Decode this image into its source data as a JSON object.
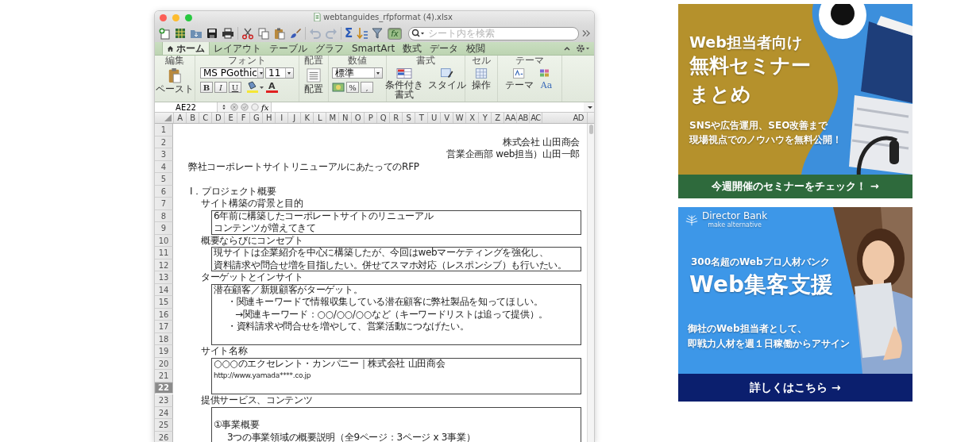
{
  "window": {
    "title": "webtanguides_rfpformat (4).xlsx"
  },
  "toolbar": {
    "buttons": [
      {
        "kind": "new",
        "disabled": false
      },
      {
        "kind": "gallery",
        "disabled": false
      },
      {
        "kind": "open",
        "disabled": false
      },
      {
        "kind": "save",
        "disabled": false
      },
      {
        "kind": "print",
        "disabled": false
      },
      {
        "kind": "cut",
        "disabled": false
      },
      {
        "kind": "copy",
        "disabled": false
      },
      {
        "kind": "paste",
        "disabled": false
      },
      {
        "kind": "brush",
        "disabled": false
      },
      {
        "kind": "undo",
        "disabled": true
      },
      {
        "kind": "redo",
        "disabled": true
      },
      {
        "kind": "sum",
        "disabled": false,
        "label": "Σ"
      },
      {
        "kind": "sort",
        "disabled": false
      },
      {
        "kind": "filter",
        "disabled": false
      },
      {
        "kind": "function",
        "disabled": false,
        "label": "fx",
        "selected": true
      }
    ],
    "search": {
      "placeholder": "シート内を検索"
    }
  },
  "tabs": [
    {
      "label": "ホーム",
      "selected": true
    },
    {
      "label": "レイアウト",
      "selected": false
    },
    {
      "label": "テーブル",
      "selected": false
    },
    {
      "label": "グラフ",
      "selected": false
    },
    {
      "label": "SmartArt",
      "selected": false
    },
    {
      "label": "数式",
      "selected": false
    },
    {
      "label": "データ",
      "selected": false
    },
    {
      "label": "校閲",
      "selected": false
    }
  ],
  "ribbon": {
    "groups": [
      "編集",
      "フォント",
      "配置",
      "数値",
      "書式",
      "セル",
      "テーマ"
    ],
    "paste": "ペースト",
    "font": "MS PGothic",
    "size": "11",
    "bold": "B",
    "italic": "I",
    "underline": "U",
    "font_color": "A",
    "align": "配置",
    "number_format": "標準",
    "percent": "%",
    "comma": ",",
    "conditional": [
      "条件付き",
      "書式"
    ],
    "styles": "スタイル",
    "cells": "操作",
    "themes": "テーマ",
    "theme_fonts": "Aa"
  },
  "formula_bar": {
    "name_box": "AE22",
    "fx": "fx"
  },
  "columns": [
    "A",
    "B",
    "C",
    "D",
    "E",
    "F",
    "G",
    "H",
    "I",
    "J",
    "K",
    "L",
    "M",
    "N",
    "O",
    "P",
    "Q",
    "R",
    "S",
    "T",
    "U",
    "V",
    "W",
    "X",
    "Y",
    "Z",
    "AA",
    "AB",
    "AC",
    "AD"
  ],
  "rows": [
    {
      "number": "1",
      "kind": "plain",
      "selected": false
    },
    {
      "number": "2",
      "kind": "right",
      "selected": false,
      "text": "株式会社 山田商会"
    },
    {
      "number": "3",
      "kind": "right",
      "selected": false,
      "text": "営業企画部 web担当）山田一郎"
    },
    {
      "number": "4",
      "kind": "plain",
      "selected": false,
      "text": "弊社コーポレートサイトリニューアルにあたってのRFP"
    },
    {
      "number": "5",
      "kind": "plain",
      "selected": false
    },
    {
      "number": "6",
      "kind": "heading",
      "selected": false,
      "text": "Ⅰ．プロジェクト概要"
    },
    {
      "number": "7",
      "kind": "sub",
      "selected": false,
      "text": "サイト構築の背景と目的"
    },
    {
      "number": "8",
      "kind": "box",
      "selected": false,
      "text": "6年前に構築したコーポレートサイトのリニューアル"
    },
    {
      "number": "9",
      "kind": "box",
      "selected": false,
      "text": "コンテンツが増えてきて"
    },
    {
      "number": "10",
      "kind": "sub",
      "selected": false,
      "text": "概要ならびにコンセプト"
    },
    {
      "number": "11",
      "kind": "box",
      "selected": false,
      "text": "現サイトは企業紹介を中心に構築したが、今回はwebマーケティングを強化し、"
    },
    {
      "number": "12",
      "kind": "box",
      "selected": false,
      "text": "資料請求や問合せ増を目指したい。併せてスマホ対応（レスポンシブ）も行いたい。"
    },
    {
      "number": "13",
      "kind": "sub",
      "selected": false,
      "text": "ターゲットとインサイト"
    },
    {
      "number": "14",
      "kind": "box",
      "selected": false,
      "text": "潜在顧客／新規顧客がターゲット。"
    },
    {
      "number": "15",
      "kind": "box-indent",
      "selected": false,
      "text": "・関連キーワードで情報収集している潜在顧客に弊社製品を知ってほしい。"
    },
    {
      "number": "16",
      "kind": "box-indent2",
      "selected": false,
      "text": "→関連キーワード：○○/○○/○○など（キーワードリストは追って提供）。"
    },
    {
      "number": "17",
      "kind": "box-indent",
      "selected": false,
      "text": "・資料請求や問合せを増やして、営業活動につなげたい。"
    },
    {
      "number": "18",
      "kind": "box",
      "selected": false
    },
    {
      "number": "19",
      "kind": "sub",
      "selected": false,
      "text": "サイト名称"
    },
    {
      "number": "20",
      "kind": "box",
      "selected": false,
      "text": "○○○のエクセレント・カンパニー｜株式会社 山田商会"
    },
    {
      "number": "21",
      "kind": "box-url",
      "selected": false,
      "text": "http://www.yamada****.co.jp"
    },
    {
      "number": "22",
      "kind": "box",
      "selected": true
    },
    {
      "number": "23",
      "kind": "sub",
      "selected": false,
      "text": "提供サービス、コンテンツ"
    },
    {
      "number": "24",
      "kind": "box",
      "selected": false
    },
    {
      "number": "25",
      "kind": "box",
      "selected": false,
      "text": "①事業概要"
    },
    {
      "number": "26",
      "kind": "box-indent",
      "selected": false,
      "text": "3つの事業領域の概要説明（全9ページ：3ページ x 3事業）"
    }
  ],
  "ads": [
    {
      "kind": "seminar",
      "lead": "Web担当者向け",
      "headline": [
        "無料セミナー",
        "まとめ"
      ],
      "body": [
        "SNSや広告運用、SEO改善まで",
        "現場視点でのノウハウを無料公開！"
      ],
      "cta": "今週開催のセミナーをチェック！ →"
    },
    {
      "kind": "staffing",
      "brand": "Director Bank",
      "tagline": "make alternative",
      "lead": "300名超のWebプロ人材バンク",
      "headline": [
        "Web集客支援"
      ],
      "body": [
        "御社のWeb担当者として、",
        "即戦力人材を週１日稼働からアサイン"
      ],
      "cta": "詳しくはこちら →"
    }
  ]
}
